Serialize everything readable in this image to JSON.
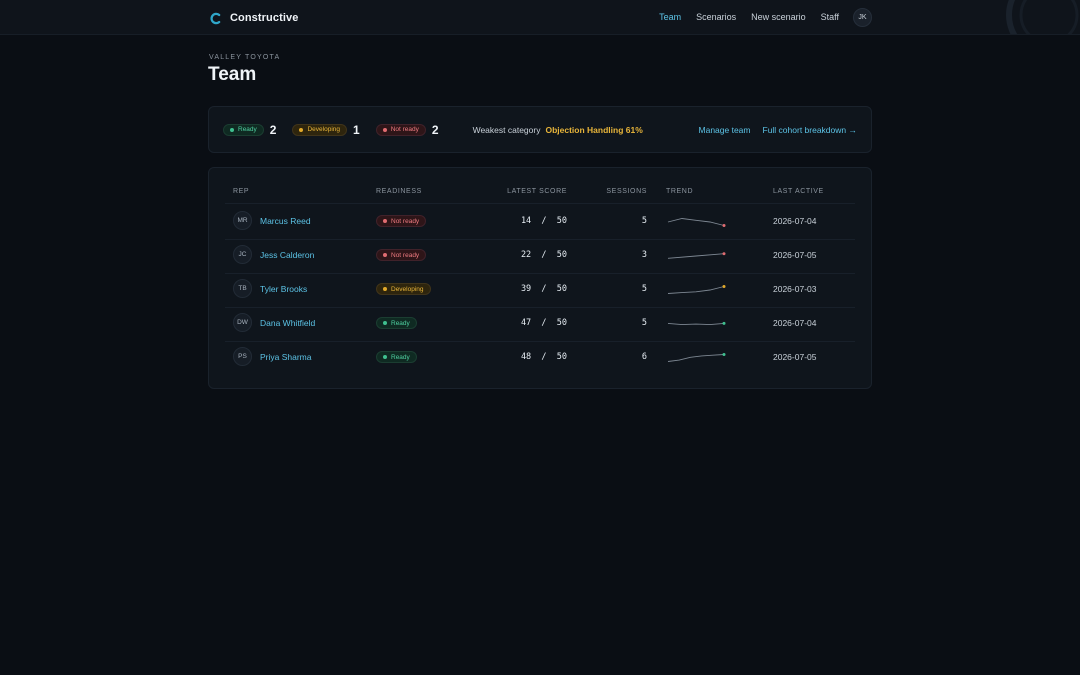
{
  "app": {
    "name": "Constructive"
  },
  "nav": {
    "items": [
      {
        "label": "Team",
        "active": true
      },
      {
        "label": "Scenarios",
        "active": false
      },
      {
        "label": "New scenario",
        "active": false
      },
      {
        "label": "Staff",
        "active": false
      }
    ],
    "user_initials": "JK"
  },
  "page": {
    "org": "VALLEY TOYOTA",
    "title": "Team"
  },
  "summary": {
    "ready": {
      "label": "Ready",
      "count": "2"
    },
    "developing": {
      "label": "Developing",
      "count": "1"
    },
    "not_ready": {
      "label": "Not ready",
      "count": "2"
    },
    "weakest_label": "Weakest category",
    "weakest_value": "Objection Handling 61%",
    "manage_team": "Manage team",
    "full_breakdown": "Full cohort breakdown →"
  },
  "table": {
    "headers": {
      "rep": "REP",
      "readiness": "READINESS",
      "latest_score": "LATEST SCORE",
      "sessions": "SESSIONS",
      "trend": "TREND",
      "last_active": "LAST ACTIVE"
    },
    "rows": [
      {
        "initials": "MR",
        "name": "Marcus Reed",
        "readiness": "Not ready",
        "status": "notready",
        "score": "14  /  50",
        "sessions": "5",
        "trend": [
          15,
          17,
          16,
          15,
          13
        ],
        "last_active": "2026-07-04"
      },
      {
        "initials": "JC",
        "name": "Jess Calderon",
        "readiness": "Not ready",
        "status": "notready",
        "score": "22  /  50",
        "sessions": "3",
        "trend": [
          20,
          21,
          22
        ],
        "last_active": "2026-07-05"
      },
      {
        "initials": "TB",
        "name": "Tyler Brooks",
        "readiness": "Developing",
        "status": "dev",
        "score": "39  /  50",
        "sessions": "5",
        "trend": [
          35,
          35.5,
          36,
          37,
          39
        ],
        "last_active": "2026-07-03"
      },
      {
        "initials": "DW",
        "name": "Dana Whitfield",
        "readiness": "Ready",
        "status": "ready",
        "score": "47  /  50",
        "sessions": "5",
        "trend": [
          47,
          46.5,
          46.7,
          46.5,
          47
        ],
        "last_active": "2026-07-04"
      },
      {
        "initials": "PS",
        "name": "Priya Sharma",
        "readiness": "Ready",
        "status": "ready",
        "score": "48  /  50",
        "sessions": "6",
        "trend": [
          43,
          44,
          46,
          47,
          47.5,
          48
        ],
        "last_active": "2026-07-05"
      }
    ]
  },
  "colors": {
    "accent": "#5cc3e6",
    "ready": "#3fc08f",
    "developing": "#e2a92a",
    "not_ready": "#e06c71"
  }
}
